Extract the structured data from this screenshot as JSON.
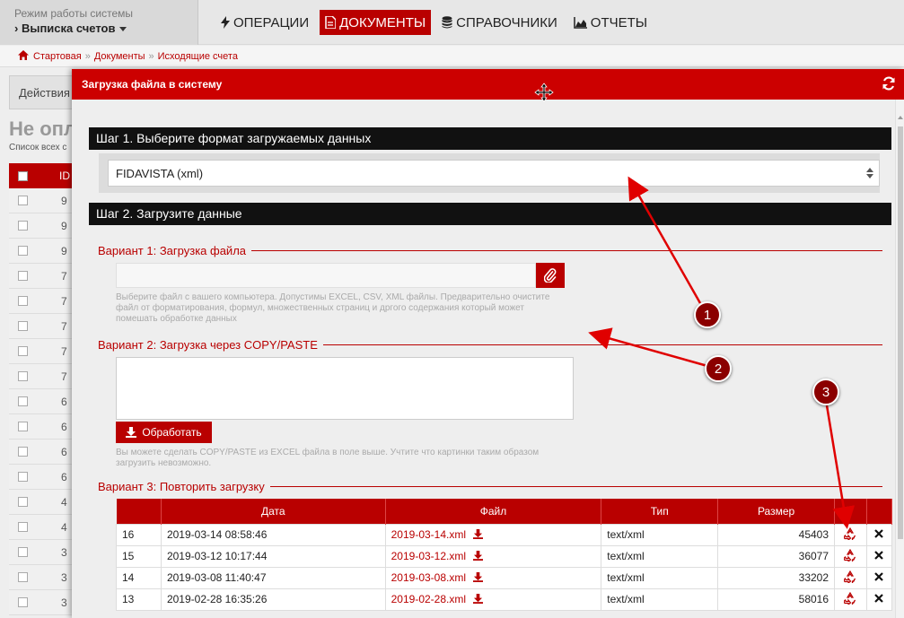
{
  "topbar": {
    "mode_caption": "Режим работы системы",
    "mode_value": "Выписка счетов",
    "nav": [
      {
        "label": "ОПЕРАЦИИ",
        "icon": "bolt-icon"
      },
      {
        "label": "ДОКУМЕНТЫ",
        "icon": "document-icon",
        "active": true
      },
      {
        "label": "СПРАВОЧНИКИ",
        "icon": "database-icon"
      },
      {
        "label": "ОТЧЕТЫ",
        "icon": "area-chart-icon"
      }
    ]
  },
  "breadcrumb": [
    "Стартовая",
    "Документы",
    "Исходящие счета"
  ],
  "background": {
    "actions_label": "Действия",
    "title": "Не опл",
    "subtitle": "Список всех с",
    "table_header": "ID",
    "row_ids": [
      "9",
      "9",
      "9",
      "7",
      "7",
      "7",
      "7",
      "7",
      "6",
      "6",
      "6",
      "6",
      "4",
      "4",
      "3",
      "3",
      "3"
    ]
  },
  "modal": {
    "title": "Загрузка файла в систему",
    "step1": "Шаг 1. Выберите формат загружаемых данных",
    "format_selected": "FIDAVISTA (xml)",
    "step2": "Шаг 2. Загрузите данные",
    "variant1": "Вариант 1: Загрузка файла",
    "variant1_hint": "Выберите файл с вашего компьютера. Допустимы EXCEL, CSV, XML файлы. Предварительно очистите файл от форматирования, формул, множественных страниц и дргого содержания который может помешать обработке данных",
    "variant2": "Вариант 2: Загрузка через COPY/PASTE",
    "process_button": "Обработать",
    "variant2_hint": "Вы можете сделать COPY/PASTE из EXCEL файла в поле выше. Учтите что картинки таким образом загрузить невозможно.",
    "variant3": "Вариант 3: Повторить загрузку",
    "history_columns": [
      "",
      "Дата",
      "Файл",
      "Тип",
      "Размер",
      "",
      ""
    ],
    "history_rows": [
      {
        "id": "16",
        "date": "2019-03-14 08:58:46",
        "file": "2019-03-14.xml",
        "type": "text/xml",
        "size": "45403"
      },
      {
        "id": "15",
        "date": "2019-03-12 10:17:44",
        "file": "2019-03-12.xml",
        "type": "text/xml",
        "size": "36077"
      },
      {
        "id": "14",
        "date": "2019-03-08 11:40:47",
        "file": "2019-03-08.xml",
        "type": "text/xml",
        "size": "33202"
      },
      {
        "id": "13",
        "date": "2019-02-28 16:35:26",
        "file": "2019-02-28.xml",
        "type": "text/xml",
        "size": "58016"
      }
    ]
  },
  "annotations": [
    "1",
    "2",
    "3"
  ],
  "colors": {
    "accent": "#cc0000",
    "dark_accent": "#b90000",
    "step_bg": "#111111",
    "badge": "#8b0000"
  }
}
